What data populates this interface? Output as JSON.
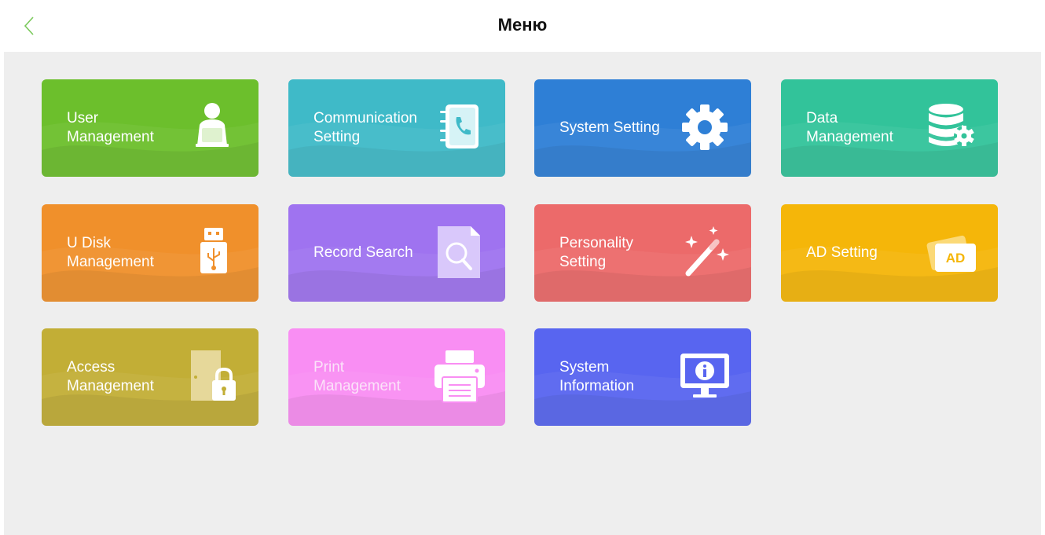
{
  "header": {
    "title": "Меню",
    "back_icon": "chevron-left-icon"
  },
  "tiles": [
    {
      "id": "user-management",
      "label": "User\nManagement",
      "icon": "user-desk-icon",
      "color": "#6cbf2c"
    },
    {
      "id": "communication-setting",
      "label": "Communication\nSetting",
      "icon": "phonebook-icon",
      "color": "#3fbac8"
    },
    {
      "id": "system-setting",
      "label": "System Setting",
      "icon": "gear-icon",
      "color": "#2e7fd6"
    },
    {
      "id": "data-management",
      "label": "Data\nManagement",
      "icon": "database-gear-icon",
      "color": "#32c39a"
    },
    {
      "id": "u-disk-management",
      "label": "U Disk\nManagement",
      "icon": "usb-drive-icon",
      "color": "#f0902b"
    },
    {
      "id": "record-search",
      "label": "Record Search",
      "icon": "document-search-icon",
      "color": "#9f73f0"
    },
    {
      "id": "personality-setting",
      "label": "Personality\nSetting",
      "icon": "magic-wand-icon",
      "color": "#ec6a6a"
    },
    {
      "id": "ad-setting",
      "label": "AD Setting",
      "icon": "ad-card-icon",
      "color": "#f5b609",
      "icon_text": "AD"
    },
    {
      "id": "access-management",
      "label": "Access\nManagement",
      "icon": "door-lock-icon",
      "color": "#c2ae36"
    },
    {
      "id": "print-management",
      "label": "Print\nManagement",
      "icon": "printer-icon",
      "color": "#f98ef3"
    },
    {
      "id": "system-information",
      "label": "System\nInformation",
      "icon": "monitor-info-icon",
      "color": "#5865f0"
    }
  ]
}
